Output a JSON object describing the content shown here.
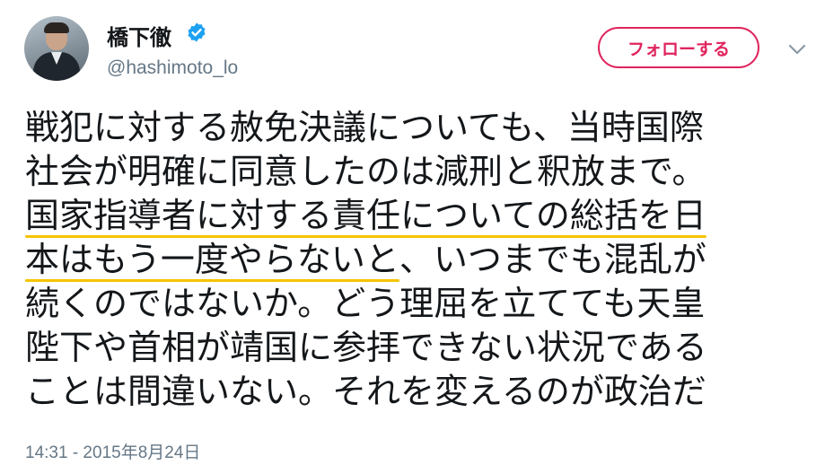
{
  "user": {
    "display_name": "橋下徹",
    "username": "@hashimoto_lo",
    "verified": true,
    "verified_color": "#1da1f2"
  },
  "follow_button": {
    "label": "フォローする",
    "color": "#e0245e"
  },
  "menu": {
    "icon": "chevron-down-icon"
  },
  "tweet": {
    "lines": [
      "戦犯に対する赦免決議についても、当時国際",
      "社会が明確に同意したのは減刑と釈放まで。",
      "国家指導者に対する責任についての総括を日",
      "本はもう一度やらないと、いつまでも混乱が",
      "続くのではないか。どう理屈を立てても天皇",
      "陛下や首相が靖国に参拝できない状況である",
      "ことは間違いない。それを変えるのが政治だ"
    ],
    "highlight_color": "#f5c400",
    "highlight_line3": "国家指導者に対する責任についての総括を日",
    "highlight_line4_part": "本はもう一度やらないと",
    "line4_rest": "、いつまでも混乱が"
  },
  "timestamp": "14:31 - 2015年8月24日"
}
